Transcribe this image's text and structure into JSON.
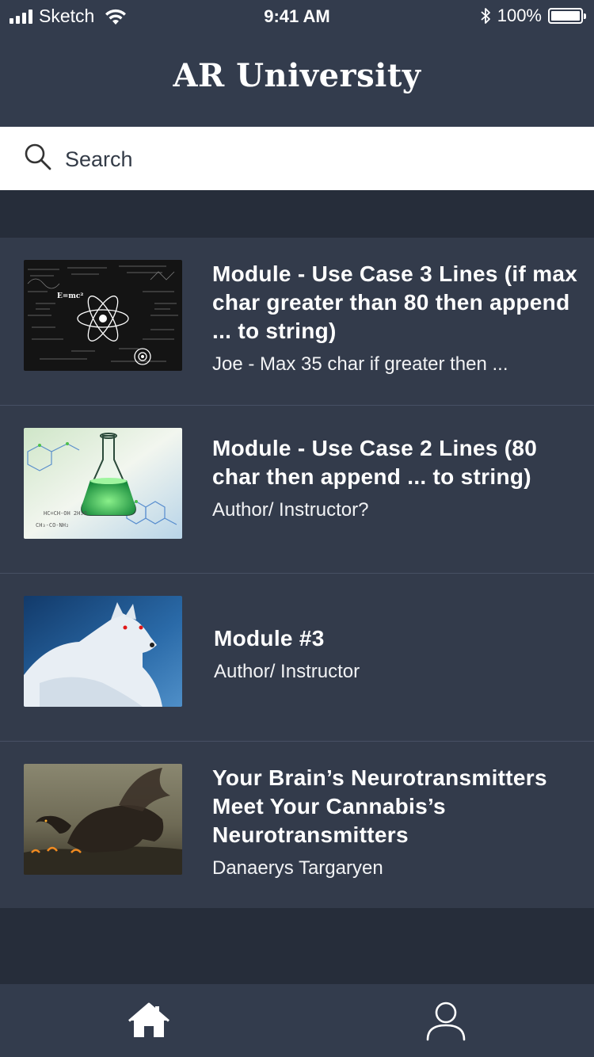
{
  "status_bar": {
    "carrier": "Sketch",
    "time": "9:41 AM",
    "battery": "100%"
  },
  "header": {
    "title": "AR University"
  },
  "search": {
    "placeholder": "Search",
    "icon": "search-icon"
  },
  "modules": [
    {
      "title": "Module - Use Case 3 Lines (if max char greater than 80 then append ... to string)",
      "subtitle": "Joe - Max 35 char if greater then ...",
      "thumbnail": "physics-chalkboard-image"
    },
    {
      "title": "Module - Use Case 2 Lines (80 char then append ... to string)",
      "subtitle": "Author/ Instructor?",
      "thumbnail": "chemistry-flask-image"
    },
    {
      "title": "Module #3",
      "subtitle": "Author/ Instructor",
      "thumbnail": "white-wolf-image"
    },
    {
      "title": "Your Brain’s Neurotransmitters Meet Your Cannabis’s Neurotransmitters",
      "subtitle": "Danaerys Targaryen",
      "thumbnail": "dragon-image"
    }
  ],
  "tab_bar": {
    "items": [
      "home-icon",
      "profile-icon"
    ]
  },
  "colors": {
    "header_bg": "#333c4d",
    "page_bg": "#262d3a",
    "card_bg": "#333b4b",
    "text": "#ffffff"
  }
}
